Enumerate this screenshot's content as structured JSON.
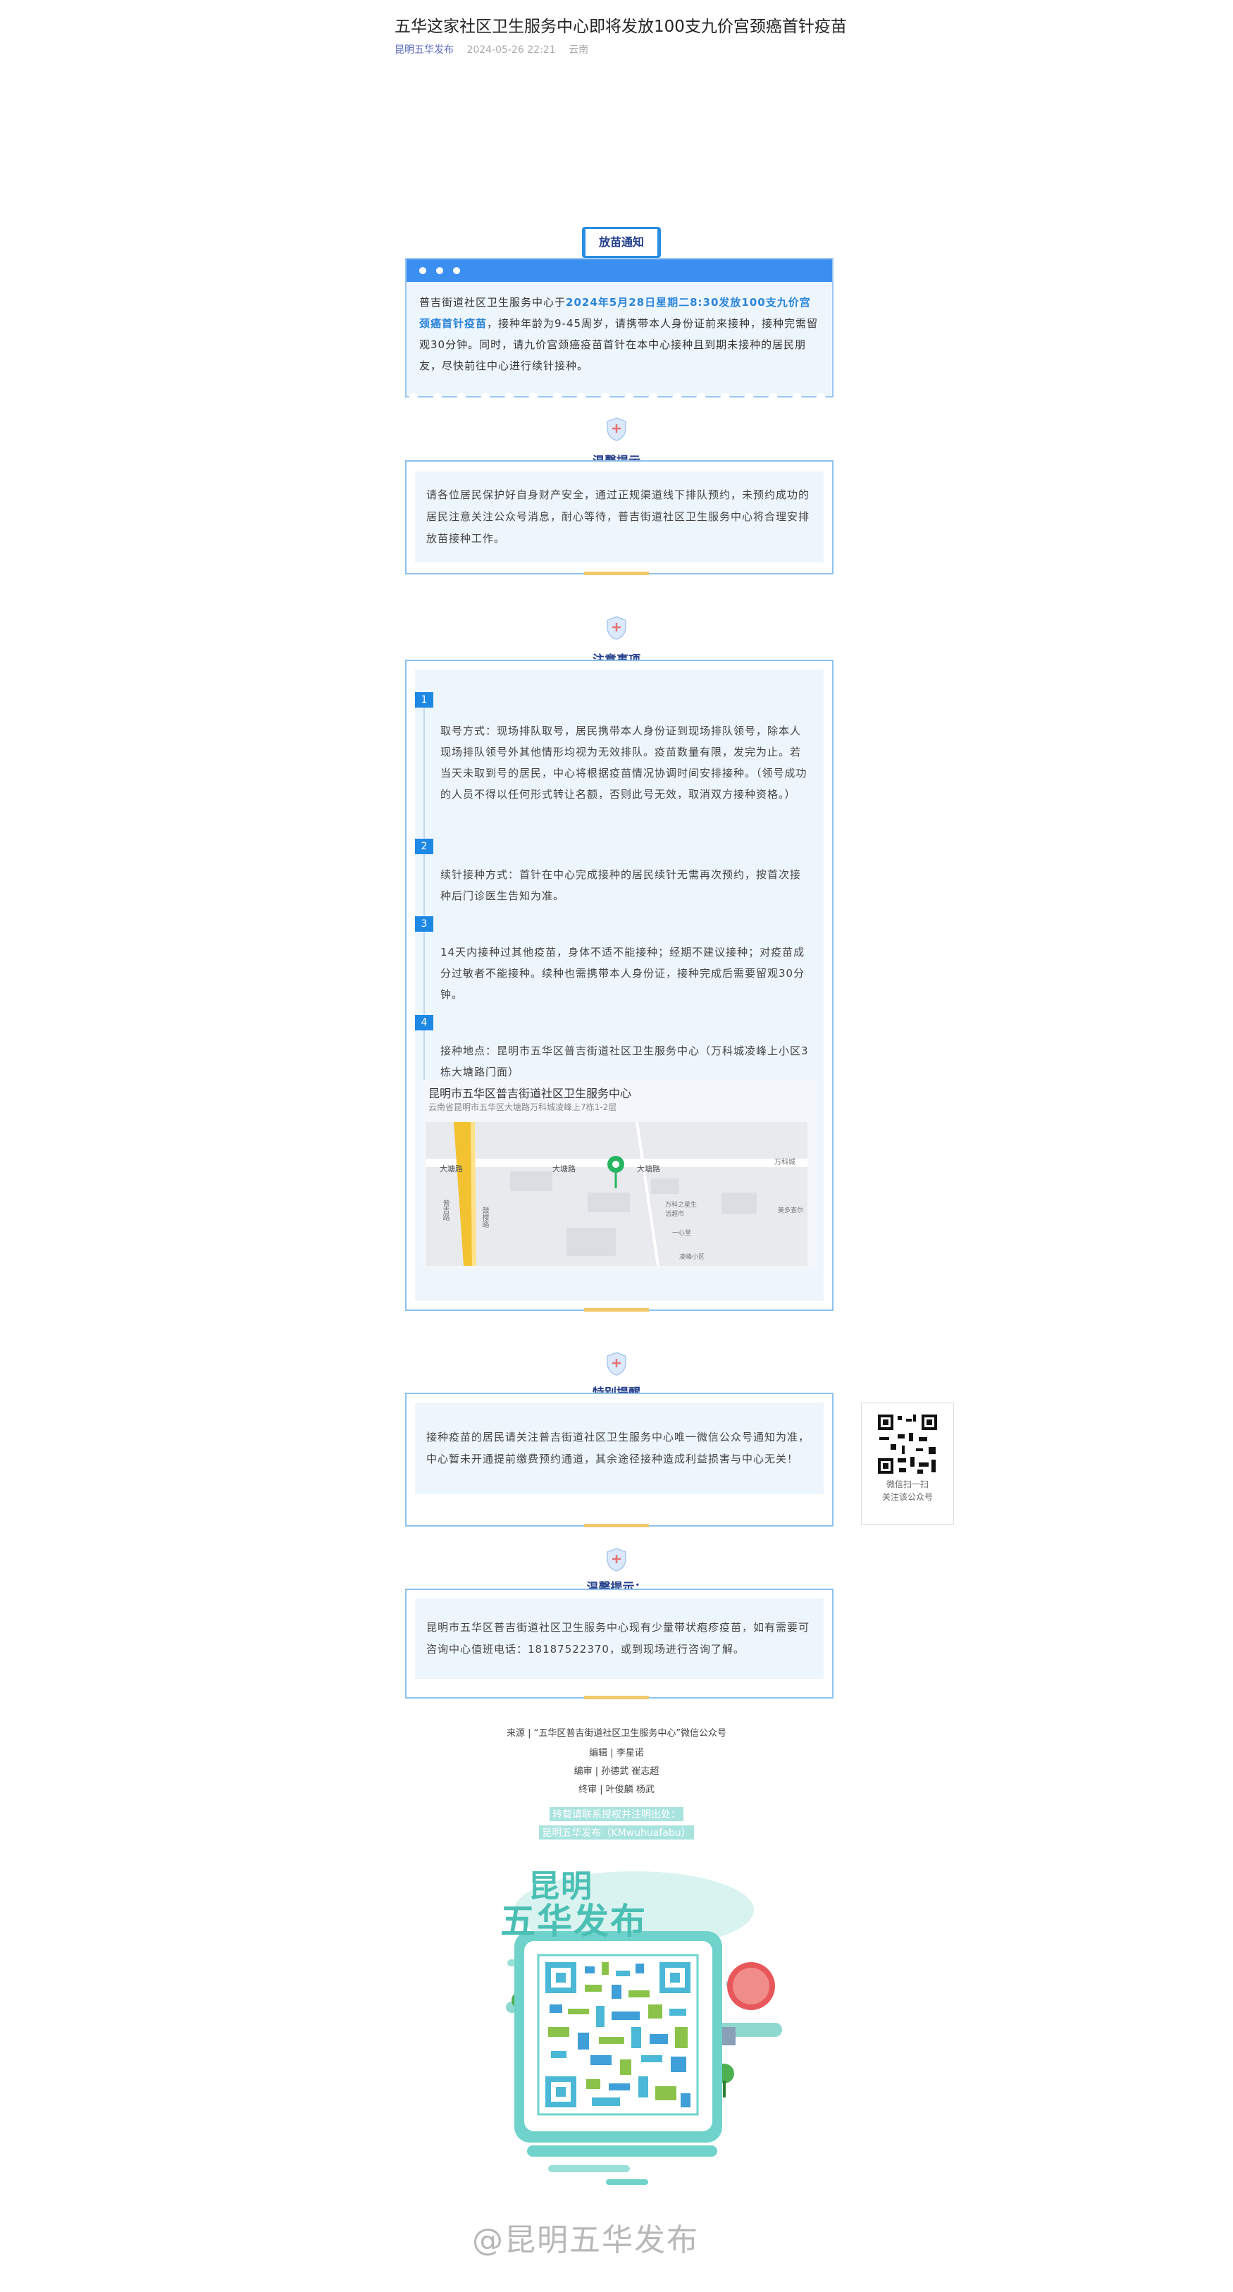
{
  "article": {
    "title": "五华这家社区卫生服务中心即将发放100支九价宫颈癌首针疫苗",
    "author": "昆明五华发布",
    "datetime": "2024-05-26 22:21",
    "location": "云南"
  },
  "notice": {
    "tag": "放苗通知",
    "text_pre": "普吉街道社区卫生服务中心于",
    "text_highlight": "2024年5月28日星期二8:30发放100支九价宫颈癌首针疫苗",
    "text_post": "，接种年龄为9-45周岁，请携带本人身份证前来接种，接种完需留观30分钟。同时，请九价宫颈癌疫苗首针在本中心接种且到期未接种的居民朋友，尽快前往中心进行续针接种。"
  },
  "tip1": {
    "title": "温馨提示",
    "text": "请各位居民保护好自身财产安全，通过正规渠道线下排队预约，未预约成功的居民注意关注公众号消息，耐心等待，普吉街道社区卫生服务中心将合理安排放苗接种工作。"
  },
  "attention": {
    "title": "注意事项",
    "items": [
      {
        "num": "1",
        "text": "取号方式：现场排队取号，居民携带本人身份证到现场排队领号，除本人现场排队领号外其他情形均视为无效排队。疫苗数量有限，发完为止。若当天未取到号的居民，中心将根据疫苗情况协调时间安排接种。（领号成功的人员不得以任何形式转让名额，否则此号无效，取消双方接种资格。）"
      },
      {
        "num": "2",
        "text": "续针接种方式：首针在中心完成接种的居民续针无需再次预约，按首次接种后门诊医生告知为准。"
      },
      {
        "num": "3",
        "text": "14天内接种过其他疫苗，身体不适不能接种；经期不建议接种；对疫苗成分过敏者不能接种。续种也需携带本人身份证，接种完成后需要留观30分钟。"
      },
      {
        "num": "4",
        "text": "接种地点：昆明市五华区普吉街道社区卫生服务中心（万科城凌峰上小区3栋大塘路门面）"
      }
    ],
    "map": {
      "title": "昆明市五华区普吉街道社区卫生服务中心",
      "address": "云南省昆明市五华区大塘路万科城凌峰上7栋1-2层",
      "labels": [
        "大塘路",
        "大塘路",
        "大塘路",
        "万科城",
        "鼓楼路",
        "普吉路",
        "万科之星生活超市",
        "一心堂",
        "凌峰小区",
        "美多查尔"
      ]
    }
  },
  "special": {
    "title": "特别提醒",
    "text": "接种疫苗的居民请关注普吉街道社区卫生服务中心唯一微信公众号通知为准，中心暂未开通提前缴费预约通道，其余途径接种造成利益损害与中心无关！"
  },
  "side_qr": {
    "caption1": "微信扫一扫",
    "caption2": "关注该公众号"
  },
  "tip2": {
    "title": "温馨提示：",
    "text": "昆明市五华区普吉街道社区卫生服务中心现有少量带状疱疹疫苗，如有需要可咨询中心值班电话：18187522370，或到现场进行咨询了解。"
  },
  "credits": {
    "source": "来源 | “五华区普吉街道社区卫生服务中心”微信公众号",
    "editor": "编辑 | 李星诺",
    "reviewer": "编审 | 孙德武  崔志超",
    "final": "终审 | 叶俊麟  杨武",
    "promo1": "转载请联系授权并注明出处：",
    "promo2": "昆明五华发布（KMwuhuafabu）"
  },
  "poster": {
    "line1": "昆明",
    "line2": "五华发布"
  },
  "watermark": "@昆明五华发布",
  "colors": {
    "primary_blue": "#3b8ff0",
    "accent_yellow": "#f2c96a",
    "light_panel": "#eef6fd",
    "teal": "#6fd3cc"
  }
}
